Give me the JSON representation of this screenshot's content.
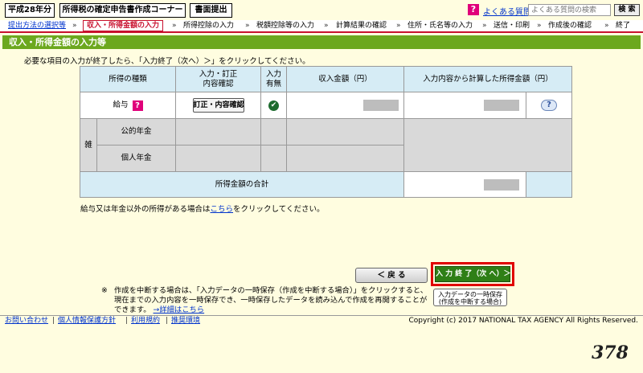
{
  "header": {
    "year": "平成28年分",
    "corner": "所得税の確定申告書作成コーナー",
    "submit": "書面提出",
    "faq_icon": "?",
    "faq_link": "よくある質問",
    "search_placeholder": "よくある質問の検索",
    "search_button": "検 索"
  },
  "steps": [
    "提出方法の選択等",
    "収入・所得金額の入力",
    "所得控除の入力",
    "税額控除等の入力",
    "計算結果の確認",
    "住所・氏名等の入力",
    "送信・印刷",
    "作成後の確認",
    "終了"
  ],
  "step_arrow": "»",
  "title": "収入・所得金額の入力等",
  "instruction": "必要な項目の入力が終了したら、「入力終了（次へ）＞」をクリックしてください。",
  "table": {
    "headers": {
      "type": "所得の種類",
      "input_line1": "入力・訂正",
      "input_line2": "内容確認",
      "done_line1": "入力",
      "done_line2": "有無",
      "income": "収入金額（円）",
      "calc": "入力内容から計算した所得金額（円）"
    },
    "salary_label": "給与",
    "salary_help_icon": "?",
    "correct_button": "訂正・内容確認",
    "salary_done": "✔",
    "help_icon": "?",
    "misc_label": "雑",
    "pension_public": "公的年金",
    "pension_private": "個人年金",
    "total_label": "所得金額の合計"
  },
  "other_note": {
    "before": "給与又は年金以外の所得がある場合は",
    "link": "こちら",
    "after": "をクリックしてください。"
  },
  "buttons": {
    "back": "＜ 戻 る",
    "next": "入 力 終 了（次 へ）＞",
    "save_line1": "入力データの一時保存",
    "save_line2": "(作成を中断する場合)"
  },
  "suspend_note": {
    "mark": "※",
    "text": "作成を中断する場合は、「入力データの一時保存（作成を中断する場合）」をクリックすると、現在までの入力内容を一時保存でき、一時保存したデータを読み込んで作成を再開することができます。",
    "link": "→詳細はこちら"
  },
  "footer": {
    "links": [
      "お問い合わせ",
      "個人情報保護方針",
      "利用規約",
      "推奨環境"
    ],
    "separator": "|",
    "copyright": "Copyright (c) 2017 NATIONAL TAX AGENCY All Rights Reserved."
  },
  "page_number": "378",
  "colors": {
    "background": "#fffde0",
    "title_bar": "#6ca81e",
    "current_step": "#c8102e",
    "next_button": "#2f7f16",
    "highlight": "#e00000",
    "table_header": "#d6ecf5"
  }
}
